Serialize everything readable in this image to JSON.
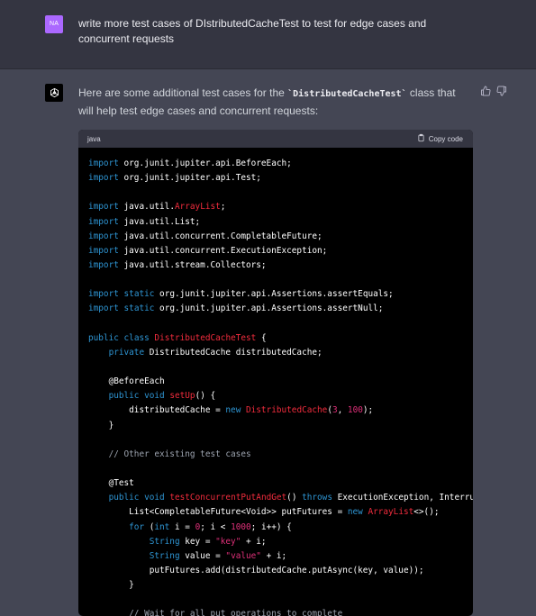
{
  "user_message": {
    "avatar_initials": "NA",
    "text": "write more test cases of DIstributedCacheTest to test for edge cases and concurrent requests"
  },
  "assistant_message": {
    "intro_prefix": "Here are some additional test cases for the ",
    "intro_code": "`DistributedCacheTest`",
    "intro_suffix": " class that will help test edge cases and concurrent requests:",
    "avatar_icon": "openai-logo-icon",
    "actions": {
      "thumbs_up_icon": "thumbs-up-icon",
      "thumbs_down_icon": "thumbs-down-icon"
    }
  },
  "code_block": {
    "language": "java",
    "copy_label": "Copy code",
    "lines": [
      "import org.junit.jupiter.api.BeforeEach;",
      "import org.junit.jupiter.api.Test;",
      "",
      "import java.util.ArrayList;",
      "import java.util.List;",
      "import java.util.concurrent.CompletableFuture;",
      "import java.util.concurrent.ExecutionException;",
      "import java.util.stream.Collectors;",
      "",
      "import static org.junit.jupiter.api.Assertions.assertEquals;",
      "import static org.junit.jupiter.api.Assertions.assertNull;",
      "",
      "public class DistributedCacheTest {",
      "    private DistributedCache distributedCache;",
      "",
      "    @BeforeEach",
      "    public void setUp() {",
      "        distributedCache = new DistributedCache(3, 100);",
      "    }",
      "",
      "    // Other existing test cases",
      "",
      "    @Test",
      "    public void testConcurrentPutAndGet() throws ExecutionException, Interru",
      "        List<CompletableFuture<Void>> putFutures = new ArrayList<>();",
      "        for (int i = 0; i < 1000; i++) {",
      "            String key = \"key\" + i;",
      "            String value = \"value\" + i;",
      "            putFutures.add(distributedCache.putAsync(key, value));",
      "        }",
      "",
      "        // Wait for all put operations to complete"
    ]
  },
  "colors": {
    "keyword": "#2e95d3",
    "class_name": "#f22c3d",
    "string": "#df3079",
    "comment": "#9ca3af"
  }
}
